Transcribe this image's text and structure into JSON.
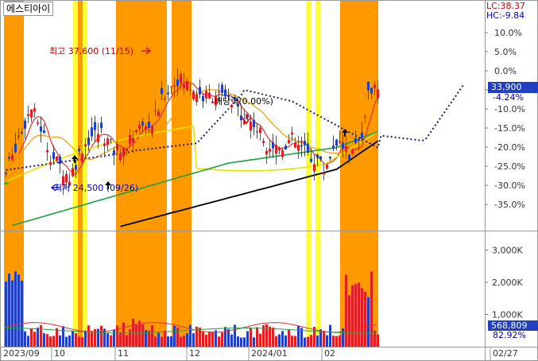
{
  "chart_data": {
    "type": "candlestick",
    "title": "에스티아이",
    "legend": {
      "lc": "LC:38.37",
      "hc": "HC:-9.84"
    },
    "price": {
      "current": "33,900",
      "current_change": "-4.24%",
      "pct_ticks": [
        "10.0%",
        "5.0%",
        "0.0%",
        "-5.0%",
        "-10.0%",
        "-15.0%",
        "-20.0%",
        "-25.0%",
        "-30.0%",
        "-35.0%"
      ],
      "pct_values": [
        10,
        5,
        0,
        -5,
        -10,
        -15,
        -20,
        -25,
        -30,
        -35
      ],
      "high_annotation": "최고 37,600 (11/15)",
      "low_annotation": "최저 24,500 (09/26)",
      "dividend_annotation": "배당락(0.00%)"
    },
    "volume": {
      "ticks": [
        "3,000K",
        "2,000K",
        "1,000K"
      ],
      "tick_values": [
        3000,
        2000,
        1000
      ],
      "current": "568,809",
      "current_pct": "82.92%"
    },
    "x_labels": [
      "2023/09",
      "10",
      "11",
      "12",
      "2024/01",
      "02",
      "02/27"
    ],
    "colors": {
      "up": "#e02020",
      "down": "#2040c0",
      "shade_orange": "#ff9900",
      "shade_yellow": "#ffff33",
      "ma5": "#e03030",
      "ma20": "#f0a000",
      "ma60": "#f0e000",
      "ma120": "#20a040",
      "ma240": "#000000",
      "cloud": "#1a1a7a"
    }
  }
}
